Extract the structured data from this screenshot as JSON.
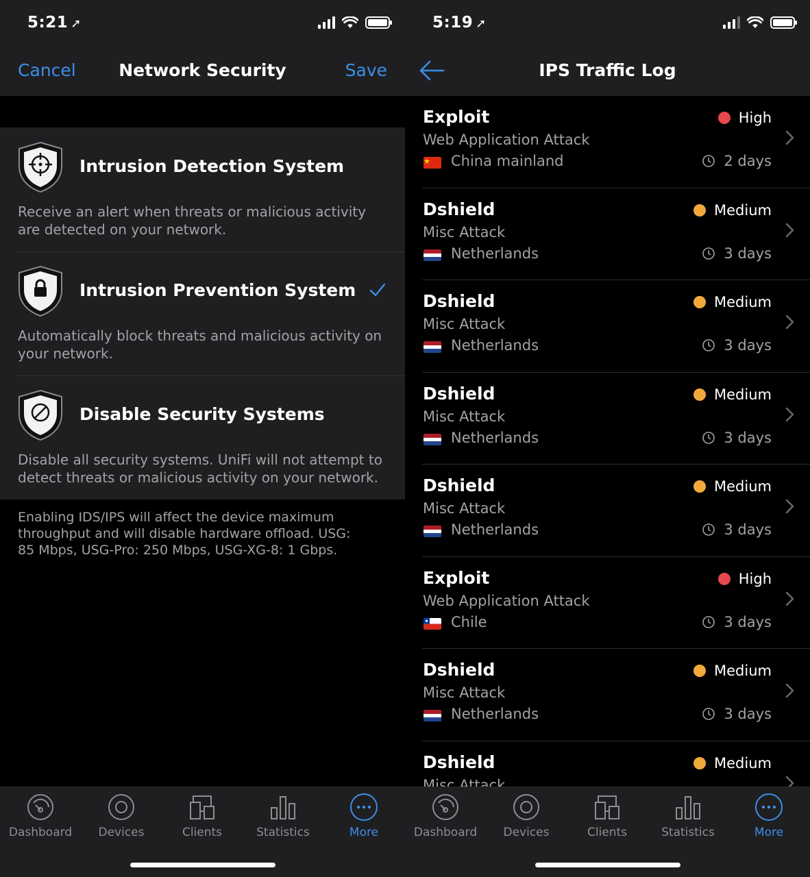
{
  "left": {
    "status": {
      "time": "5:21"
    },
    "nav": {
      "cancel": "Cancel",
      "title": "Network Security",
      "save": "Save"
    },
    "options": [
      {
        "title": "Intrusion Detection System",
        "desc": "Receive an alert when threats or malicious activity are detected on your network.",
        "icon": "crosshair-shield-icon",
        "selected": false
      },
      {
        "title": "Intrusion Prevention System",
        "desc": "Automatically block threats and malicious activity on your network.",
        "icon": "lock-shield-icon",
        "selected": true
      },
      {
        "title": "Disable Security Systems",
        "desc": "Disable all security systems. UniFi will not attempt to detect threats or malicious activity on your network.",
        "icon": "disabled-shield-icon",
        "selected": false
      }
    ],
    "footer_note": "Enabling IDS/IPS will affect the device maximum throughput and will disable hardware offload. USG: 85 Mbps, USG-Pro: 250 Mbps, USG-XG-8: 1 Gbps."
  },
  "right": {
    "status": {
      "time": "5:19"
    },
    "nav": {
      "title": "IPS Traffic Log"
    },
    "logs": [
      {
        "type": "Exploit",
        "category": "Web Application Attack",
        "country": "China mainland",
        "flag": "china",
        "severity": "High",
        "age": "2 days"
      },
      {
        "type": "Dshield",
        "category": "Misc Attack",
        "country": "Netherlands",
        "flag": "netherlands",
        "severity": "Medium",
        "age": "3 days"
      },
      {
        "type": "Dshield",
        "category": "Misc Attack",
        "country": "Netherlands",
        "flag": "netherlands",
        "severity": "Medium",
        "age": "3 days"
      },
      {
        "type": "Dshield",
        "category": "Misc Attack",
        "country": "Netherlands",
        "flag": "netherlands",
        "severity": "Medium",
        "age": "3 days"
      },
      {
        "type": "Dshield",
        "category": "Misc Attack",
        "country": "Netherlands",
        "flag": "netherlands",
        "severity": "Medium",
        "age": "3 days"
      },
      {
        "type": "Exploit",
        "category": "Web Application Attack",
        "country": "Chile",
        "flag": "chile",
        "severity": "High",
        "age": "3 days"
      },
      {
        "type": "Dshield",
        "category": "Misc Attack",
        "country": "Netherlands",
        "flag": "netherlands",
        "severity": "Medium",
        "age": "3 days"
      },
      {
        "type": "Dshield",
        "category": "Misc Attack",
        "country": "",
        "flag": "",
        "severity": "Medium",
        "age": ""
      }
    ]
  },
  "tabs": [
    {
      "label": "Dashboard",
      "icon": "dashboard-gauge-icon"
    },
    {
      "label": "Devices",
      "icon": "devices-disc-icon"
    },
    {
      "label": "Clients",
      "icon": "clients-screens-icon"
    },
    {
      "label": "Statistics",
      "icon": "statistics-bars-icon"
    },
    {
      "label": "More",
      "icon": "more-dots-icon",
      "active": true
    }
  ],
  "colors": {
    "accent": "#3b8fe8",
    "high": "#e5484d",
    "medium": "#f2a93b",
    "panel": "#1f1f21",
    "muted": "#a3a3a7"
  }
}
